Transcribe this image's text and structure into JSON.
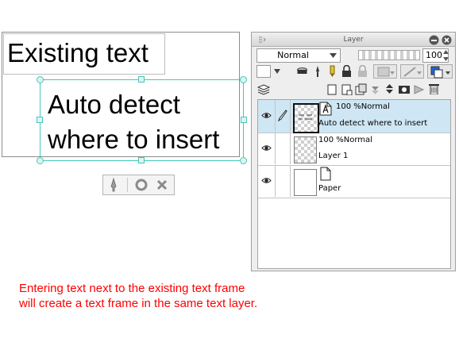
{
  "canvas": {
    "existing_text": "Existing text",
    "new_text": "Auto detect\nwhere to insert"
  },
  "layer_panel": {
    "title": "Layer",
    "blend_mode": "Normal",
    "opacity": "100",
    "layers": [
      {
        "mode": "100 %Normal",
        "name": "Auto detect  where to insert",
        "type": "text",
        "selected": true
      },
      {
        "mode": "100 %Normal",
        "name": "Layer 1",
        "type": "raster",
        "selected": false
      },
      {
        "mode": "",
        "name": "Paper",
        "type": "paper",
        "selected": false
      }
    ]
  },
  "caption": "Entering text next to the existing text frame\nwill create a text frame in the same text layer.",
  "colors": {
    "frame_handle": "#46c7b8",
    "caption": "#ff0000",
    "selected_row": "#cfe6f4"
  }
}
